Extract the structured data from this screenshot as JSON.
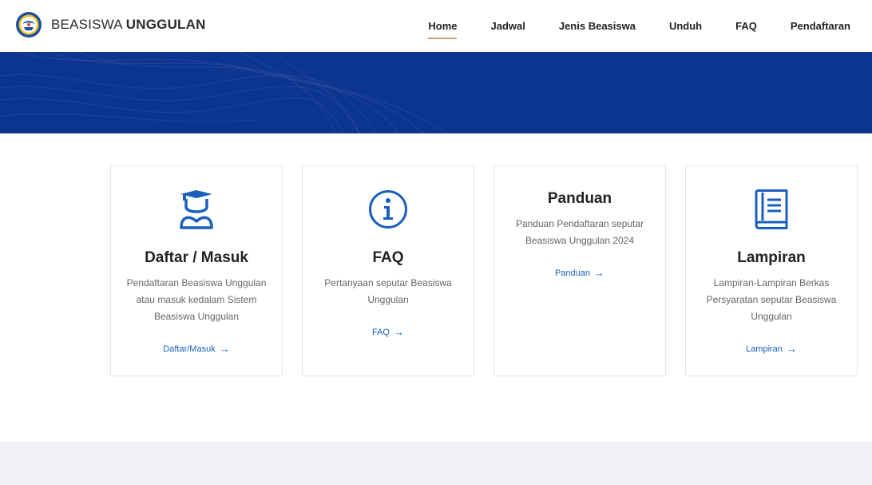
{
  "brand": {
    "title_light": "BEASISWA ",
    "title_bold": "UNGGULAN",
    "logo_icon": "tut-wuri-handayani-logo-icon"
  },
  "nav": {
    "items": [
      {
        "label": "Home",
        "active": true
      },
      {
        "label": "Jadwal"
      },
      {
        "label": "Jenis Beasiswa"
      },
      {
        "label": "Unduh"
      },
      {
        "label": "FAQ"
      },
      {
        "label": "Pendaftaran"
      }
    ]
  },
  "colors": {
    "hero": "#0c3590",
    "accent": "#1b5fbd",
    "nav_underline": "#c8a07a",
    "footer_band": "#f1f2f6"
  },
  "cards": [
    {
      "icon": "graduate-student-icon",
      "title": "Daftar / Masuk",
      "desc": "Pendaftaran Beasiswa Unggulan atau masuk kedalam Sistem Beasiswa Unggulan",
      "link": "Daftar/Masuk"
    },
    {
      "icon": "info-circle-icon",
      "title": "FAQ",
      "desc": "Pertanyaan seputar Beasiswa Unggulan",
      "link": "FAQ"
    },
    {
      "icon": "",
      "title": "Panduan",
      "desc": "Panduan Pendaftaran seputar Beasiswa Unggulan 2024",
      "link": "Panduan"
    },
    {
      "icon": "book-icon",
      "title": "Lampiran",
      "desc": "Lampiran-Lampiran Berkas Persyaratan seputar Beasiswa Unggulan",
      "link": "Lampiran"
    }
  ],
  "link_arrow": "→"
}
